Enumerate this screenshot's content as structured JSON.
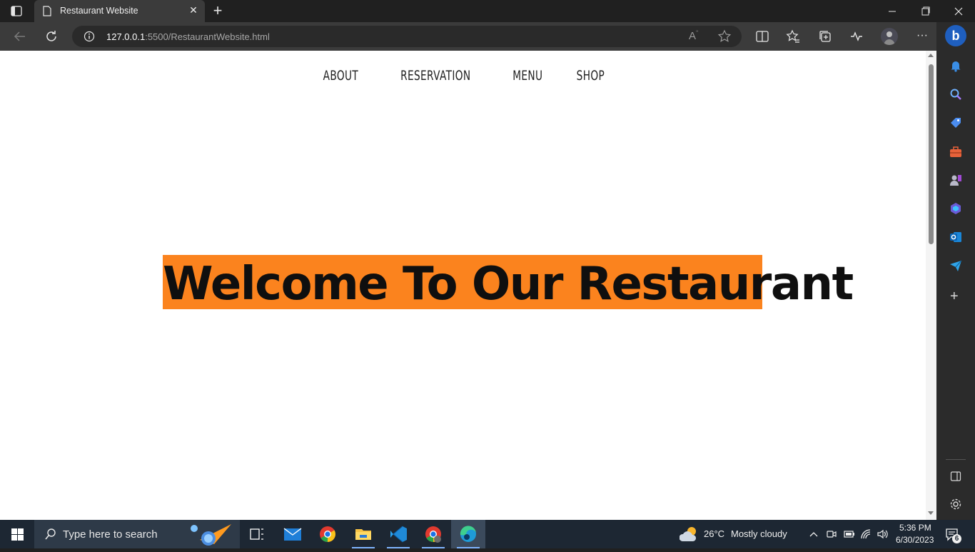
{
  "browser": {
    "tab_title": "Restaurant Website",
    "new_tab_label": "+",
    "url_host": "127.0.0.1",
    "url_rest": ":5500/RestaurantWebsite.html"
  },
  "page": {
    "nav": [
      "ABOUT",
      "RESERVATION",
      "MENU",
      "SHOP"
    ],
    "hero_title": "Welcome To Our Restaurant",
    "hero_bg": "#fb831e"
  },
  "taskbar": {
    "search_placeholder": "Type here to search",
    "weather_temp": "26°C",
    "weather_text": "Mostly cloudy",
    "time": "5:36 PM",
    "date": "6/30/2023",
    "notification_count": "6"
  },
  "sidebar_icons": [
    "bell-icon",
    "search-icon",
    "tag-icon",
    "briefcase-icon",
    "games-icon",
    "copilot-icon",
    "outlook-icon",
    "send-icon",
    "add-icon",
    "panel-icon",
    "settings-icon"
  ]
}
